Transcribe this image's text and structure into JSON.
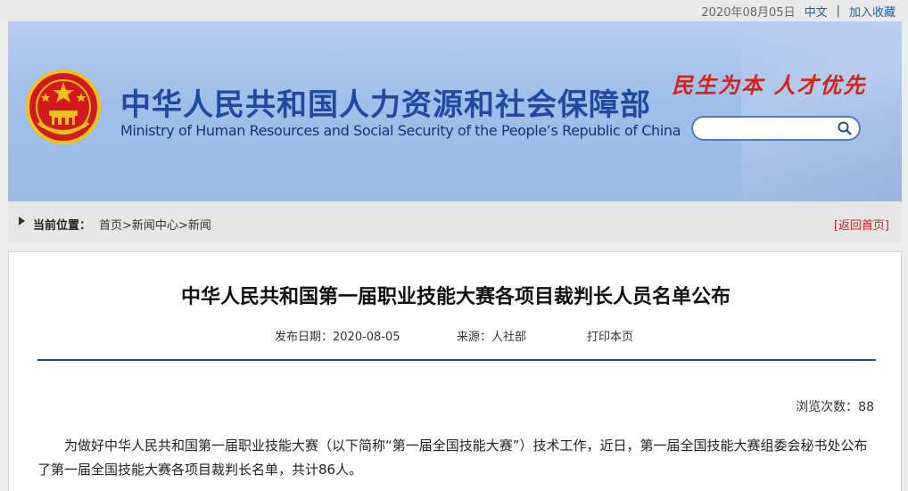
{
  "topbar": {
    "date": "2020年08月05日",
    "lang": "中文",
    "divider": "|",
    "favorite": "加入收藏"
  },
  "header": {
    "cn_title": "中华人民共和国人力资源和社会保障部",
    "en_title": "Ministry of Human Resources and Social Security of the People’s Republic of China",
    "slogan": "民生为本 人才优先",
    "search_placeholder": ""
  },
  "breadcrumb": {
    "label": "当前位置：",
    "items": [
      "首页",
      "新闻中心",
      "新闻"
    ],
    "separator": ">",
    "back": "[返回首页]"
  },
  "article": {
    "title": "中华人民共和国第一届职业技能大赛各项目裁判长人员名单公布",
    "publish_date": "发布日期：2020-08-05",
    "source": "来源：人社部",
    "print": "打印本页",
    "views": "浏览次数：88",
    "paragraph": "为做好中华人民共和国第一届职业技能大赛（以下简称“第一届全国技能大赛”）技术工作，近日，第一届全国技能大赛组委会秘书处公布了第一届全国技能大赛各项目裁判长名单，共计86人。"
  },
  "colors": {
    "brand_blue": "#1f4aa0",
    "slogan_red": "#d1241c",
    "emblem_red": "#d4191c",
    "emblem_gold": "#f2c21b"
  },
  "icons": {
    "emblem": "national-emblem-icon",
    "search": "search-icon",
    "crumb": "triangle-right-icon"
  }
}
